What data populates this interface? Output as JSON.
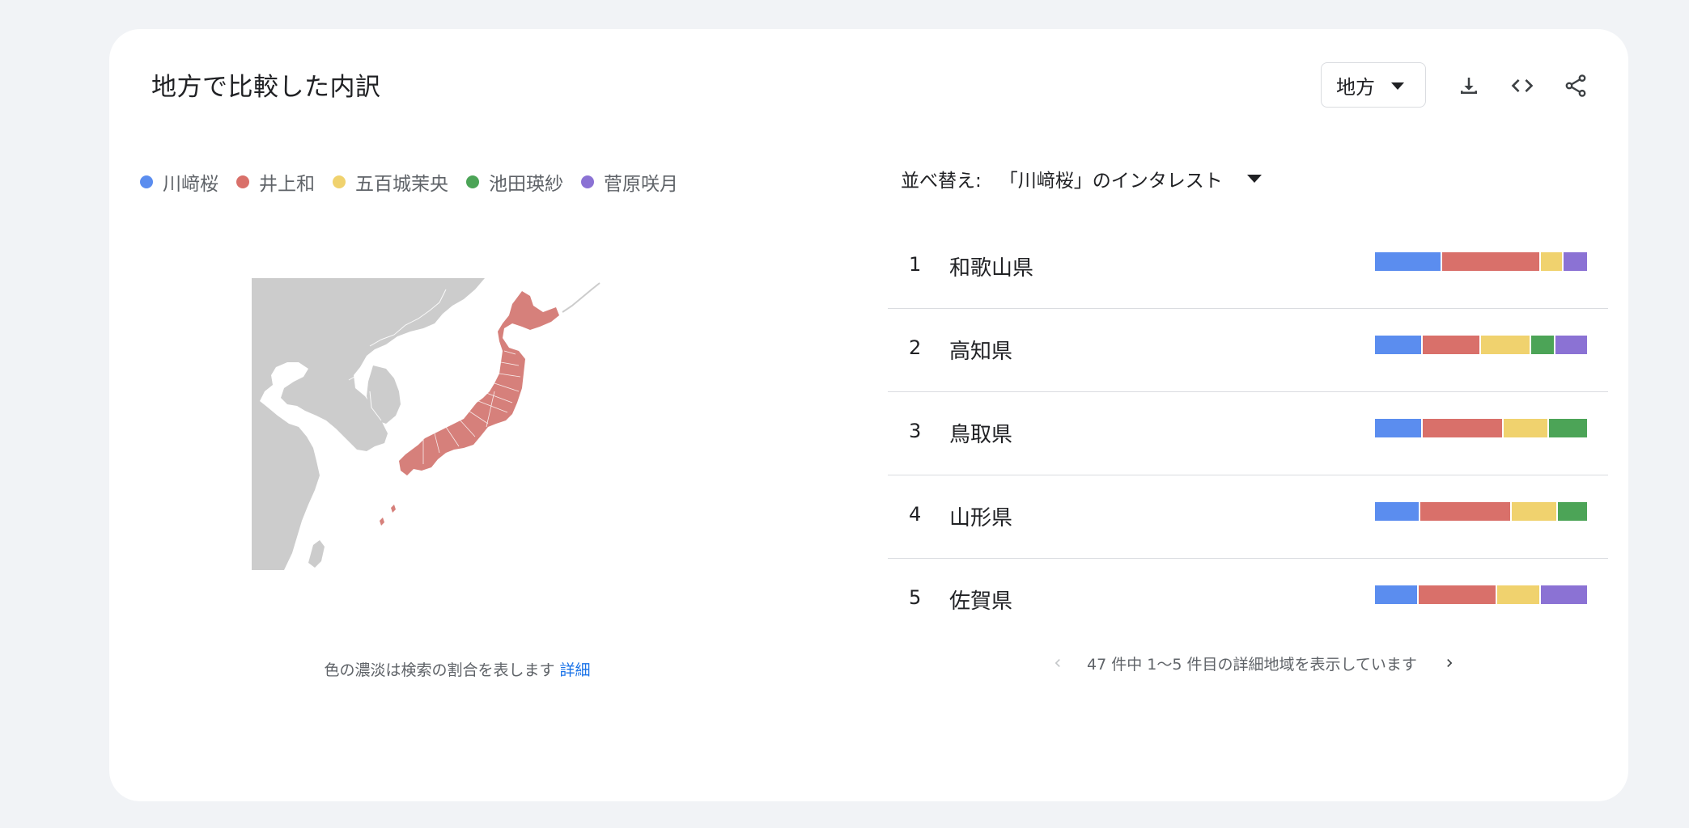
{
  "header": {
    "title": "地方で比較した内訳",
    "geo_select": "地方"
  },
  "toolbar": {
    "download_icon": "download-icon",
    "embed_icon": "embed-code-icon",
    "share_icon": "share-icon"
  },
  "legend": [
    {
      "label": "川﨑桜",
      "color": "#5b8def"
    },
    {
      "label": "井上和",
      "color": "#d9706a"
    },
    {
      "label": "五百城茉央",
      "color": "#f0d26e"
    },
    {
      "label": "池田瑛紗",
      "color": "#4ca457"
    },
    {
      "label": "菅原咲月",
      "color": "#8b72d4"
    }
  ],
  "map": {
    "note": "色の濃淡は検索の割合を表します",
    "link": "詳細",
    "land_color": "#cccccc",
    "region_color": "#d6807b"
  },
  "sort": {
    "label": "並べ替え:",
    "value": "「川﨑桜」のインタレスト"
  },
  "ranking": [
    {
      "rank": "1",
      "name": "和歌山県",
      "shares": [
        31,
        46,
        10,
        0,
        11
      ]
    },
    {
      "rank": "2",
      "name": "高知県",
      "shares": [
        22,
        27,
        23,
        11,
        15
      ]
    },
    {
      "rank": "3",
      "name": "鳥取県",
      "shares": [
        22,
        38,
        21,
        18,
        0
      ]
    },
    {
      "rank": "4",
      "name": "山形県",
      "shares": [
        21,
        43,
        21,
        14,
        0
      ]
    },
    {
      "rank": "5",
      "name": "佐賀県",
      "shares": [
        20,
        37,
        20,
        0,
        22
      ]
    }
  ],
  "pagination": {
    "text": "47 件中 1〜5 件目の詳細地域を表示しています"
  }
}
